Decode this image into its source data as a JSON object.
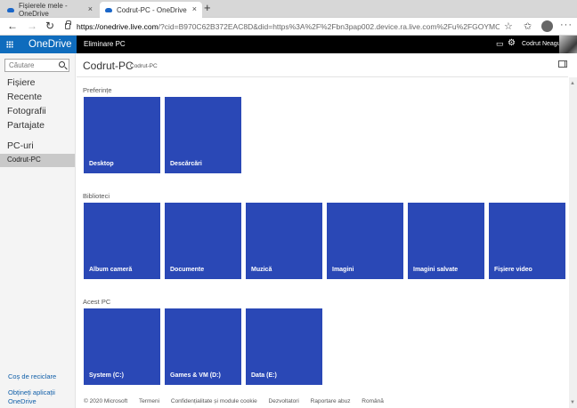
{
  "browser": {
    "tabs": [
      {
        "label": "Fișierele mele - OneDrive"
      },
      {
        "label": "Codrut-PC - OneDrive"
      }
    ],
    "new_tab": "+",
    "close": "×",
    "url_domain": "https://onedrive.live.com",
    "url_rest": "/?cid=B970C62B372EAC8D&did=https%3A%2F%2Fbn3pap002.device.ra.live.com%2Fu%2FGOYMON3KOYMPACQ5JS...",
    "more": "···"
  },
  "suitebar": {
    "brand": "OneDrive",
    "title": "Eliminare PC",
    "user": "Codrut Neagu"
  },
  "search": {
    "placeholder": "Căutare"
  },
  "nav": {
    "items": [
      "Fișiere",
      "Recente",
      "Fotografii",
      "Partajate"
    ],
    "pcs_heading": "PC-uri",
    "selected": "Codrut-PC",
    "recycle_bin": "Coș de reciclare",
    "get_apps": "Obțineți aplicații OneDrive"
  },
  "main": {
    "title": "Codrut-PC",
    "subtitle": "Codrut-PC",
    "sections": [
      {
        "label": "Preferințe",
        "tiles": [
          "Desktop",
          "Descărcări"
        ]
      },
      {
        "label": "Biblioteci",
        "tiles": [
          "Album cameră",
          "Documente",
          "Muzică",
          "Imagini",
          "Imagini salvate",
          "Fișiere video"
        ]
      },
      {
        "label": "Acest PC",
        "tiles": [
          "System (C:)",
          "Games & VM (D:)",
          "Data (E:)"
        ]
      }
    ]
  },
  "footer": [
    "© 2020 Microsoft",
    "Termeni",
    "Confidențialitate și module cookie",
    "Dezvoltatori",
    "Raportare abuz",
    "Română"
  ],
  "colors": {
    "tile": "#2a48b6",
    "brand": "#0f6cbd",
    "suitebar": "#000000"
  }
}
